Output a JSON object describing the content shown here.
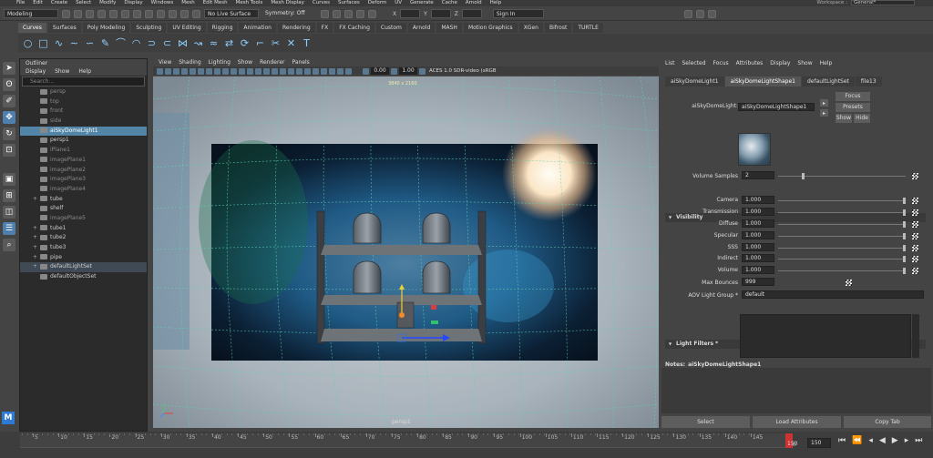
{
  "menubar": {
    "items": [
      "File",
      "Edit",
      "Create",
      "Select",
      "Modify",
      "Display",
      "Windows",
      "Mesh",
      "Edit Mesh",
      "Mesh Tools",
      "Mesh Display",
      "Curves",
      "Surfaces",
      "Deform",
      "UV",
      "Generate",
      "Cache",
      "Arnold",
      "Help"
    ],
    "workspace_label": "Workspace :",
    "workspace_value": "General*"
  },
  "statusline": {
    "mode": "Modeling",
    "live_surface": "No Live Surface",
    "symmetry": "Symmetry: Off",
    "sign_in": "Sign In",
    "x_label": "X",
    "y_label": "Y",
    "z_label": "Z"
  },
  "shelf": {
    "tabs": [
      "Curves",
      "Surfaces",
      "Poly Modeling",
      "Sculpting",
      "UV Editing",
      "Rigging",
      "Animation",
      "Rendering",
      "FX",
      "FX Caching",
      "Custom",
      "Arnold",
      "MASH",
      "Motion Graphics",
      "XGen",
      "Bifrost",
      "TURTLE"
    ],
    "active": "Curves"
  },
  "outliner": {
    "title": "Outliner",
    "menu": [
      "Display",
      "Show",
      "Help"
    ],
    "search_placeholder": "Search...",
    "items": [
      {
        "label": "persp",
        "style": "grey",
        "expand": ""
      },
      {
        "label": "top",
        "style": "grey",
        "expand": ""
      },
      {
        "label": "front",
        "style": "grey",
        "expand": ""
      },
      {
        "label": "side",
        "style": "grey",
        "expand": ""
      },
      {
        "label": "aiSkyDomeLight1",
        "style": "hl",
        "expand": ""
      },
      {
        "label": "persp1",
        "style": "",
        "expand": ""
      },
      {
        "label": "iPlane1",
        "style": "grey",
        "expand": ""
      },
      {
        "label": "imagePlane1",
        "style": "grey",
        "expand": ""
      },
      {
        "label": "imagePlane2",
        "style": "grey",
        "expand": ""
      },
      {
        "label": "imagePlane3",
        "style": "grey",
        "expand": ""
      },
      {
        "label": "imagePlane4",
        "style": "grey",
        "expand": ""
      },
      {
        "label": "tube",
        "style": "",
        "expand": "+"
      },
      {
        "label": "shelf",
        "style": "",
        "expand": ""
      },
      {
        "label": "imagePlane5",
        "style": "grey",
        "expand": ""
      },
      {
        "label": "tube1",
        "style": "",
        "expand": "+"
      },
      {
        "label": "tube2",
        "style": "",
        "expand": "+"
      },
      {
        "label": "tube3",
        "style": "",
        "expand": "+"
      },
      {
        "label": "pipe",
        "style": "",
        "expand": "+"
      },
      {
        "label": "defaultLightSet",
        "style": "hl2",
        "expand": "+"
      },
      {
        "label": "defaultObjectSet",
        "style": "",
        "expand": ""
      }
    ]
  },
  "viewport": {
    "menu": [
      "View",
      "Shading",
      "Lighting",
      "Show",
      "Renderer",
      "Panels"
    ],
    "field1": "0.00",
    "field2": "1.00",
    "colorspace": "ACES 1.0 SDR-video (sRGB",
    "resolution": "3840 x 2160",
    "camera": "persp1"
  },
  "attribute_editor": {
    "menu": [
      "List",
      "Selected",
      "Focus",
      "Attributes",
      "Display",
      "Show",
      "Help"
    ],
    "tabs": [
      "aiSkyDomeLight1",
      "aiSkyDomeLightShape1",
      "defaultLightSet",
      "file13"
    ],
    "active_tab": "aiSkyDomeLightShape1",
    "node_label": "aiSkyDomeLight:",
    "node_value": "aiSkyDomeLightShape1",
    "focus": "Focus",
    "presets": "Presets",
    "show": "Show",
    "hide": "Hide",
    "volume_samples_label": "Volume Samples",
    "volume_samples_value": "2",
    "visibility_title": "Visibility",
    "visibility": [
      {
        "label": "Camera",
        "value": "1.000",
        "frac": 1.0
      },
      {
        "label": "Transmission",
        "value": "1.000",
        "frac": 1.0
      },
      {
        "label": "Diffuse",
        "value": "1.000",
        "frac": 1.0
      },
      {
        "label": "Specular",
        "value": "1.000",
        "frac": 1.0
      },
      {
        "label": "SSS",
        "value": "1.000",
        "frac": 1.0
      },
      {
        "label": "Indirect",
        "value": "1.000",
        "frac": 1.0
      },
      {
        "label": "Volume",
        "value": "1.000",
        "frac": 1.0
      }
    ],
    "max_bounces_label": "Max Bounces",
    "max_bounces_value": "999",
    "aov_label": "AOV Light Group *",
    "aov_value": "default",
    "filters_title": "Light Filters *",
    "notes_label": "Notes:",
    "notes_value": "aiSkyDomeLightShape1",
    "buttons": {
      "select": "Select",
      "load": "Load Attributes",
      "copy": "Copy Tab"
    }
  },
  "timeline": {
    "ticks": [
      "5",
      "10",
      "15",
      "20",
      "25",
      "30",
      "35",
      "40",
      "45",
      "50",
      "55",
      "60",
      "65",
      "70",
      "75",
      "80",
      "85",
      "90",
      "95",
      "100",
      "105",
      "110",
      "115",
      "120",
      "125",
      "130",
      "135",
      "140",
      "145"
    ],
    "end_frame": "150",
    "current_frame": "150",
    "current_frame_field": "150"
  }
}
